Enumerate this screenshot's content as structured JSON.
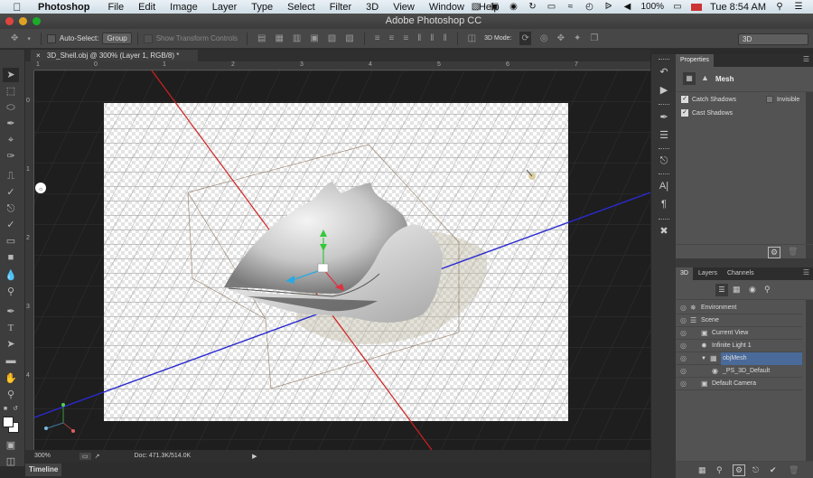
{
  "menubar": {
    "apple_icon": "apple-icon",
    "app_name": "Photoshop",
    "items": [
      "File",
      "Edit",
      "Image",
      "Layer",
      "Type",
      "Select",
      "Filter",
      "3D",
      "View",
      "Window",
      "Help"
    ],
    "status": {
      "battery": "100%",
      "clock": "Tue 8:54 AM"
    }
  },
  "window": {
    "title": "Adobe Photoshop CC"
  },
  "options_bar": {
    "auto_select_label": "Auto-Select:",
    "auto_select_checked": false,
    "group_value": "Group",
    "show_transform_label": "Show Transform Controls",
    "show_transform_checked": false,
    "mode_3d_label": "3D Mode:",
    "workspace_value": "3D"
  },
  "document": {
    "tab_title": "3D_Shell.obj @ 300% (Layer 1, RGB/8) *",
    "ruler_h_labels": [
      "1",
      "0",
      "1",
      "2",
      "3",
      "4",
      "5",
      "6",
      "7"
    ],
    "ruler_v_labels": [
      "0",
      "1",
      "2",
      "3",
      "4"
    ]
  },
  "statusbar": {
    "zoom": "300%",
    "doc_info": "Doc: 471.3K/514.0K"
  },
  "timeline": {
    "label": "Timeline"
  },
  "properties": {
    "title": "Properties",
    "mesh_label": "Mesh",
    "catch_shadows_label": "Catch Shadows",
    "catch_shadows_checked": true,
    "invisible_label": "Invisible",
    "invisible_checked": false,
    "cast_shadows_label": "Cast Shadows",
    "cast_shadows_checked": true
  },
  "panel3d": {
    "tabs": [
      "3D",
      "Layers",
      "Channels"
    ],
    "active_tab": "3D",
    "items": [
      {
        "label": "Environment",
        "icon": "environment-icon",
        "indent": 0
      },
      {
        "label": "Scene",
        "icon": "scene-icon",
        "indent": 0
      },
      {
        "label": "Current View",
        "icon": "camera-icon",
        "indent": 1
      },
      {
        "label": "Infinite Light 1",
        "icon": "light-icon",
        "indent": 1
      },
      {
        "label": "objMesh",
        "icon": "mesh-icon",
        "indent": 1,
        "selected": true,
        "expanded": true
      },
      {
        "label": "_PS_3D_Default",
        "icon": "material-icon",
        "indent": 2
      },
      {
        "label": "Default Camera",
        "icon": "camera-icon",
        "indent": 1
      }
    ]
  },
  "colors": {
    "x_axis": "#d02020",
    "y_axis": "#2a2ad0",
    "gizmo_green": "#35c83a",
    "gizmo_blue": "#2aa8e0",
    "gizmo_red": "#e03040",
    "selection": "#4a6a9a"
  }
}
